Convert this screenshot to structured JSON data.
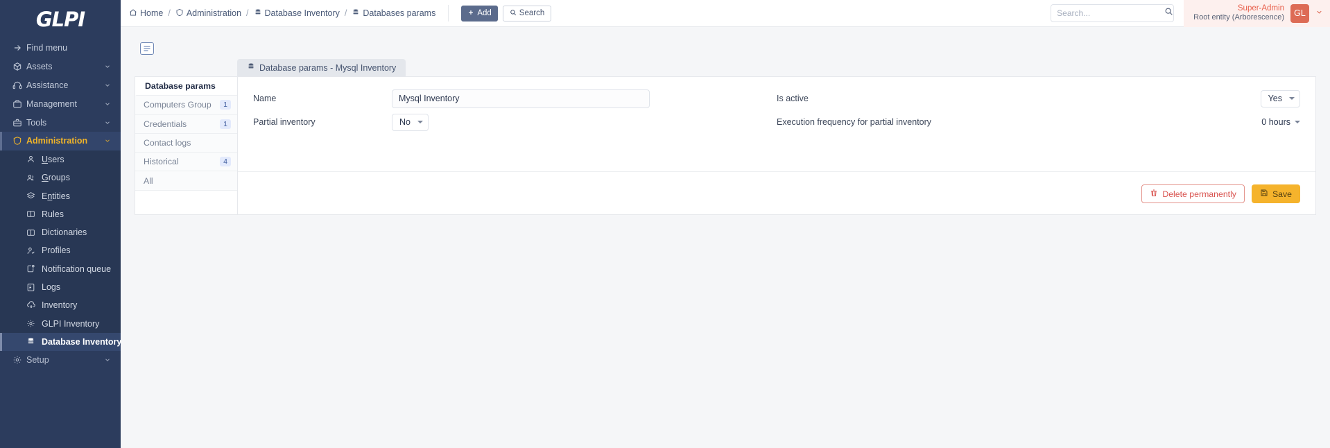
{
  "app": {
    "logo": "GLPI"
  },
  "sidebar": {
    "find_menu": "Find menu",
    "items": [
      {
        "label": "Assets",
        "icon": "box-icon"
      },
      {
        "label": "Assistance",
        "icon": "headset-icon"
      },
      {
        "label": "Management",
        "icon": "briefcase-alt-icon"
      },
      {
        "label": "Tools",
        "icon": "toolbox-icon"
      },
      {
        "label": "Administration",
        "icon": "shield-icon"
      }
    ],
    "admin_children": [
      {
        "label": "Users",
        "accesskey": "U",
        "icon": "user-icon"
      },
      {
        "label": "Groups",
        "accesskey": "G",
        "icon": "users-icon"
      },
      {
        "label": "Entities",
        "accesskey": "E",
        "icon": "layers-icon"
      },
      {
        "label": "Rules",
        "accesskey": "",
        "icon": "book-icon"
      },
      {
        "label": "Dictionaries",
        "accesskey": "",
        "icon": "book-open-icon"
      },
      {
        "label": "Profiles",
        "accesskey": "",
        "icon": "user-check-icon"
      },
      {
        "label": "Notification queue",
        "accesskey": "",
        "icon": "bell-queue-icon"
      },
      {
        "label": "Logs",
        "accesskey": "",
        "icon": "list-details-icon"
      },
      {
        "label": "Inventory",
        "accesskey": "",
        "icon": "cloud-download-icon"
      },
      {
        "label": "GLPI Inventory",
        "accesskey": "",
        "icon": "gear-icon"
      },
      {
        "label": "Database Inventory",
        "accesskey": "",
        "icon": "database-icon"
      }
    ],
    "setup": {
      "label": "Setup",
      "icon": "gear-icon"
    }
  },
  "topbar": {
    "breadcrumb": [
      {
        "label": "Home",
        "icon": "home-icon"
      },
      {
        "label": "Administration",
        "icon": "shield-icon"
      },
      {
        "label": "Database Inventory",
        "icon": "database-icon"
      },
      {
        "label": "Databases params",
        "icon": "database-icon"
      }
    ],
    "separator": "/",
    "add_button": "Add",
    "search_button": "Search",
    "search_placeholder": "Search...",
    "user": {
      "name": "Super-Admin",
      "entity": "Root entity (Arborescence)",
      "initials": "GL"
    }
  },
  "page": {
    "tab_header": "Database params - Mysql Inventory",
    "side_tabs": [
      {
        "label": "Database params",
        "badge": ""
      },
      {
        "label": "Computers Group",
        "badge": "1"
      },
      {
        "label": "Credentials",
        "badge": "1"
      },
      {
        "label": "Contact logs",
        "badge": ""
      },
      {
        "label": "Historical",
        "badge": "4"
      },
      {
        "label": "All",
        "badge": ""
      }
    ],
    "form": {
      "name_label": "Name",
      "name_value": "Mysql Inventory",
      "is_active_label": "Is active",
      "is_active_value": "Yes",
      "partial_inventory_label": "Partial inventory",
      "partial_inventory_value": "No",
      "execution_frequency_label": "Execution frequency for partial inventory",
      "execution_frequency_value": "0 hours"
    },
    "actions": {
      "delete": "Delete permanently",
      "save": "Save"
    }
  },
  "colors": {
    "sidebar": "#2c3c5d",
    "accent": "#f0b429",
    "save": "#f5b32c",
    "delete": "#d9534f",
    "user": "#dd6b55"
  }
}
